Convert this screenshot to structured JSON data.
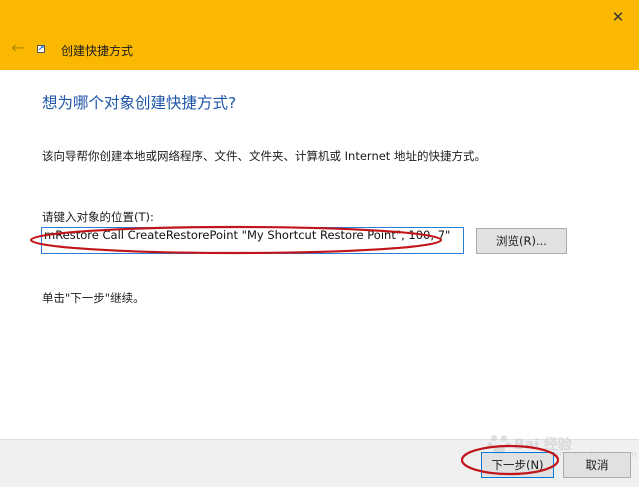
{
  "window": {
    "title": "创建快捷方式",
    "close_glyph": "✕",
    "back_glyph": "←"
  },
  "content": {
    "heading": "想为哪个对象创建快捷方式?",
    "description": "该向导帮你创建本地或网络程序、文件、文件夹、计算机或 Internet 地址的快捷方式。",
    "location_label": "请键入对象的位置(T):",
    "location_value": "mRestore Call CreateRestorePoint \"My Shortcut Restore Point\", 100, 7\"",
    "browse_label": "浏览(R)...",
    "continue_hint": "单击\"下一步\"继续。"
  },
  "footer": {
    "next_label": "下一步(N)",
    "cancel_label": "取消"
  },
  "watermark": {
    "text": "Bai 经验",
    "sub": "jingyan.baidu.com"
  },
  "colors": {
    "titlebar": "#fbb800",
    "heading": "#1f56a8",
    "annotation": "#c0161b",
    "focus_border": "#0078d7"
  }
}
